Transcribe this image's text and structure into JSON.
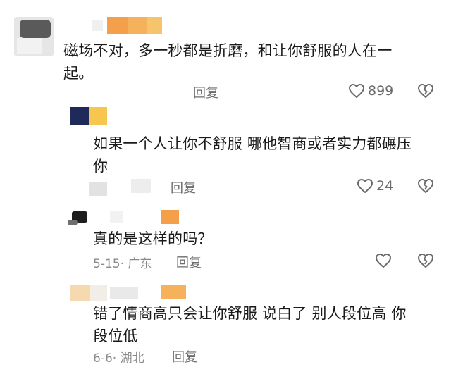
{
  "colors": {
    "text": "#1a1a1a",
    "muted": "#8a8a8a",
    "icon": "#6b6b6b",
    "blur_orange": "#f4a04a",
    "blur_yellow": "#f6c64e",
    "blur_navy": "#1f2a5a"
  },
  "comments": [
    {
      "text": "磁场不对，多一秒都是折磨，和让你舒服的人在一起。",
      "line1": "磁场不对，多一秒都是折磨，和让你舒服的人在一",
      "line2": "起。",
      "reply_label": "回复",
      "likes": "899",
      "like_icon": "heart-outline-icon",
      "dislike_icon": "broken-heart-icon"
    },
    {
      "text": "如果一个人让你不舒服 哪他智商或者实力都碾压你",
      "line1": "如果一个人让你不舒服 哪他智商或者实力都碾压",
      "line2": "你",
      "reply_label": "回复",
      "likes": "24",
      "like_icon": "heart-outline-icon",
      "dislike_icon": "broken-heart-icon"
    },
    {
      "text": "真的是这样的吗？",
      "date": "5-15",
      "location": "广东",
      "meta": "5-15· 广东",
      "reply_label": "回复",
      "like_icon": "heart-outline-icon",
      "dislike_icon": "broken-heart-icon"
    },
    {
      "text": "错了情商高只会让你舒服 说白了 别人段位高 你段位低",
      "line1": "错了情商高只会让你舒服 说白了 别人段位高 你",
      "line2": "段位低",
      "date": "6-6",
      "location": "湖北",
      "meta": "6-6· 湖北",
      "reply_label": "回复"
    }
  ]
}
